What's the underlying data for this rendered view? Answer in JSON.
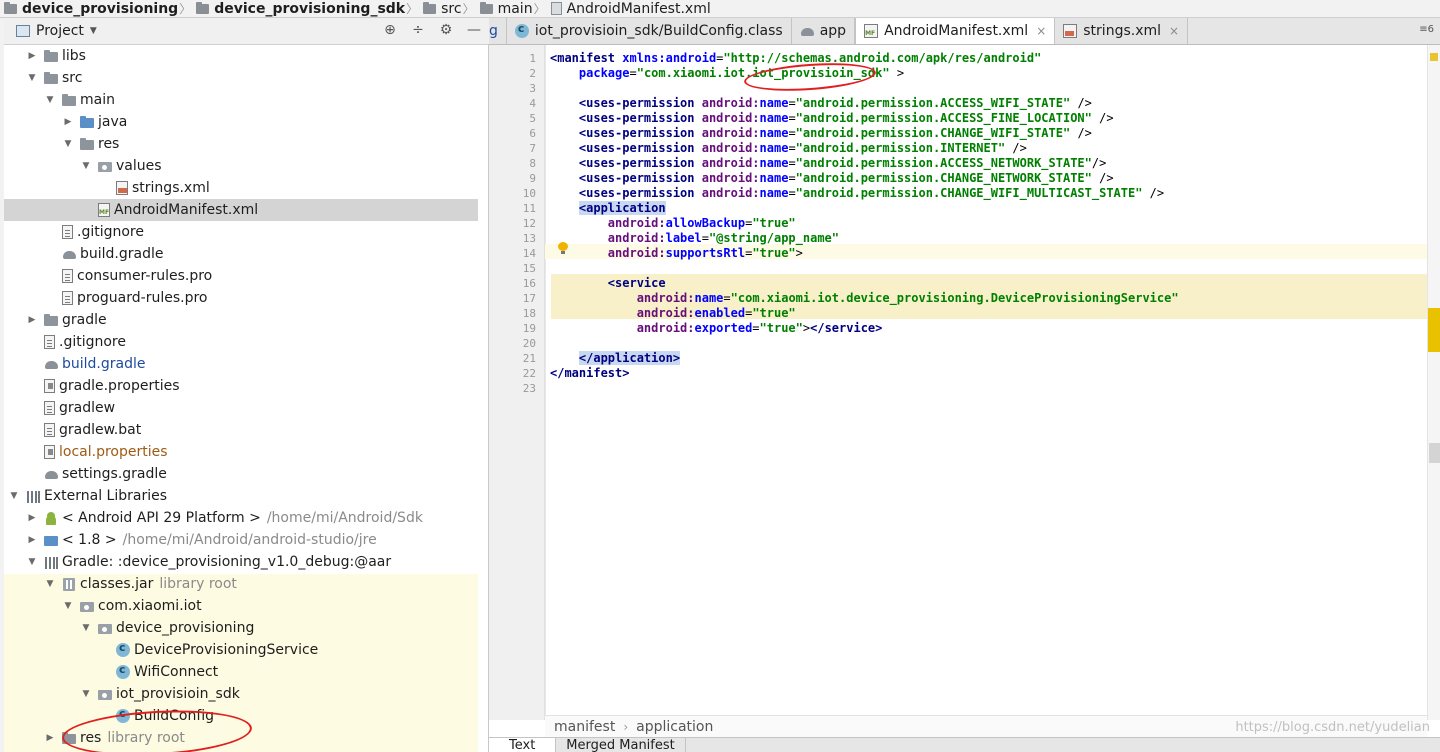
{
  "breadcrumb": {
    "items": [
      "device_provisioning",
      "device_provisioning_sdk",
      "src",
      "main",
      "AndroidManifest.xml"
    ]
  },
  "project_pane": {
    "title": "Project",
    "tools": [
      "⊕",
      "÷",
      "⚙",
      "—"
    ]
  },
  "tree": [
    {
      "indent": 1,
      "arrow": "▶",
      "icon": "folder-icon",
      "label": "libs"
    },
    {
      "indent": 1,
      "arrow": "▼",
      "icon": "folder-icon",
      "label": "src"
    },
    {
      "indent": 2,
      "arrow": "▼",
      "icon": "folder-icon",
      "label": "main"
    },
    {
      "indent": 3,
      "arrow": "▶",
      "icon": "folder-blue-icon",
      "label": "java"
    },
    {
      "indent": 3,
      "arrow": "▼",
      "icon": "res-folder-icon",
      "label": "res"
    },
    {
      "indent": 4,
      "arrow": "▼",
      "icon": "package-icon",
      "label": "values"
    },
    {
      "indent": 5,
      "arrow": "",
      "icon": "xml-file-icon",
      "label": "strings.xml"
    },
    {
      "indent": 4,
      "arrow": "",
      "icon": "manifest-file-icon",
      "label": "AndroidManifest.xml",
      "selected": true
    },
    {
      "indent": 2,
      "arrow": "",
      "icon": "file-icon",
      "label": ".gitignore"
    },
    {
      "indent": 2,
      "arrow": "",
      "icon": "gradle-icon",
      "label": "build.gradle"
    },
    {
      "indent": 2,
      "arrow": "",
      "icon": "file-icon",
      "label": "consumer-rules.pro"
    },
    {
      "indent": 2,
      "arrow": "",
      "icon": "file-icon",
      "label": "proguard-rules.pro"
    },
    {
      "indent": 1,
      "arrow": "▶",
      "icon": "folder-icon",
      "label": "gradle"
    },
    {
      "indent": 1,
      "arrow": "",
      "icon": "file-icon",
      "label": ".gitignore"
    },
    {
      "indent": 1,
      "arrow": "",
      "icon": "gradle-icon",
      "label": "build.gradle",
      "color": "blue"
    },
    {
      "indent": 1,
      "arrow": "",
      "icon": "properties-icon",
      "label": "gradle.properties"
    },
    {
      "indent": 1,
      "arrow": "",
      "icon": "file-icon",
      "label": "gradlew"
    },
    {
      "indent": 1,
      "arrow": "",
      "icon": "file-icon",
      "label": "gradlew.bat"
    },
    {
      "indent": 1,
      "arrow": "",
      "icon": "properties-icon",
      "label": "local.properties",
      "color": "brown"
    },
    {
      "indent": 1,
      "arrow": "",
      "icon": "gradle-icon",
      "label": "settings.gradle"
    },
    {
      "indent": 0,
      "arrow": "▼",
      "icon": "libraries-icon",
      "label": "External Libraries"
    },
    {
      "indent": 1,
      "arrow": "▶",
      "icon": "android-icon",
      "label": "< Android API 29 Platform >",
      "path": "/home/mi/Android/Sdk"
    },
    {
      "indent": 1,
      "arrow": "▶",
      "icon": "jdk-icon",
      "label": "< 1.8 >",
      "path": "/home/mi/Android/android-studio/jre"
    },
    {
      "indent": 1,
      "arrow": "▼",
      "icon": "libraries-icon",
      "label": "Gradle: :device_provisioning_v1.0_debug:@aar"
    },
    {
      "indent": 2,
      "arrow": "▼",
      "icon": "jar-icon",
      "label": "classes.jar",
      "path": "library root"
    },
    {
      "indent": 3,
      "arrow": "▼",
      "icon": "package-icon",
      "label": "com.xiaomi.iot"
    },
    {
      "indent": 4,
      "arrow": "▼",
      "icon": "package-icon",
      "label": "device_provisioning"
    },
    {
      "indent": 5,
      "arrow": "",
      "icon": "class-icon",
      "label": "DeviceProvisioningService"
    },
    {
      "indent": 5,
      "arrow": "",
      "icon": "class-icon",
      "label": "WifiConnect"
    },
    {
      "indent": 4,
      "arrow": "▼",
      "icon": "package-icon",
      "label": "iot_provisioin_sdk"
    },
    {
      "indent": 5,
      "arrow": "",
      "icon": "class-icon",
      "label": "BuildConfig"
    },
    {
      "indent": 2,
      "arrow": "▶",
      "icon": "folder-icon",
      "label": "res",
      "path": "library root"
    }
  ],
  "editor": {
    "tabs": [
      {
        "label": "g",
        "icon": "",
        "cut": true
      },
      {
        "label": "iot_provisioin_sdk/BuildConfig.class",
        "icon": "class-icon",
        "close": false
      },
      {
        "label": "app",
        "icon": "gradle-icon",
        "close": false
      },
      {
        "label": "AndroidManifest.xml",
        "icon": "manifest-file-icon",
        "close": true,
        "active": true
      },
      {
        "label": "strings.xml",
        "icon": "xml-file-icon",
        "close": true
      }
    ],
    "tab_more": "≡6",
    "line_numbers": [
      "1",
      "2",
      "3",
      "4",
      "5",
      "6",
      "7",
      "8",
      "9",
      "10",
      "11",
      "12",
      "13",
      "14",
      "15",
      "16",
      "17",
      "18",
      "19",
      "20",
      "21",
      "22",
      "23"
    ],
    "code_lines": [
      [
        [
          "tag",
          "<manifest "
        ],
        [
          "attr",
          "xmlns:android"
        ],
        [
          "txt",
          "="
        ],
        [
          "str",
          "\"http://schemas.android.com/apk/res/android\""
        ]
      ],
      [
        [
          "txt",
          "    "
        ],
        [
          "attr",
          "package"
        ],
        [
          "txt",
          "="
        ],
        [
          "str",
          "\"com.xiaomi.iot.iot_provisioin_sdk\""
        ],
        [
          "txt",
          " >"
        ]
      ],
      [],
      [
        [
          "txt",
          "    "
        ],
        [
          "tag",
          "<uses-permission "
        ],
        [
          "ns",
          "android:"
        ],
        [
          "attr",
          "name"
        ],
        [
          "txt",
          "="
        ],
        [
          "str",
          "\"android.permission.ACCESS_WIFI_STATE\""
        ],
        [
          "txt",
          " />"
        ]
      ],
      [
        [
          "txt",
          "    "
        ],
        [
          "tag",
          "<uses-permission "
        ],
        [
          "ns",
          "android:"
        ],
        [
          "attr",
          "name"
        ],
        [
          "txt",
          "="
        ],
        [
          "str",
          "\"android.permission.ACCESS_FINE_LOCATION\""
        ],
        [
          "txt",
          " />"
        ]
      ],
      [
        [
          "txt",
          "    "
        ],
        [
          "tag",
          "<uses-permission "
        ],
        [
          "ns",
          "android:"
        ],
        [
          "attr",
          "name"
        ],
        [
          "txt",
          "="
        ],
        [
          "str",
          "\"android.permission.CHANGE_WIFI_STATE\""
        ],
        [
          "txt",
          " />"
        ]
      ],
      [
        [
          "txt",
          "    "
        ],
        [
          "tag",
          "<uses-permission "
        ],
        [
          "ns",
          "android:"
        ],
        [
          "attr",
          "name"
        ],
        [
          "txt",
          "="
        ],
        [
          "str",
          "\"android.permission.INTERNET\""
        ],
        [
          "txt",
          " />"
        ]
      ],
      [
        [
          "txt",
          "    "
        ],
        [
          "tag",
          "<uses-permission "
        ],
        [
          "ns",
          "android:"
        ],
        [
          "attr",
          "name"
        ],
        [
          "txt",
          "="
        ],
        [
          "str",
          "\"android.permission.ACCESS_NETWORK_STATE\""
        ],
        [
          "txt",
          "/>"
        ]
      ],
      [
        [
          "txt",
          "    "
        ],
        [
          "tag",
          "<uses-permission "
        ],
        [
          "ns",
          "android:"
        ],
        [
          "attr",
          "name"
        ],
        [
          "txt",
          "="
        ],
        [
          "str",
          "\"android.permission.CHANGE_NETWORK_STATE\""
        ],
        [
          "txt",
          " />"
        ]
      ],
      [
        [
          "txt",
          "    "
        ],
        [
          "tag",
          "<uses-permission "
        ],
        [
          "ns",
          "android:"
        ],
        [
          "attr",
          "name"
        ],
        [
          "txt",
          "="
        ],
        [
          "str",
          "\"android.permission.CHANGE_WIFI_MULTICAST_STATE\""
        ],
        [
          "txt",
          " />"
        ]
      ],
      [
        [
          "txt",
          "    "
        ],
        [
          "taghl",
          "<application"
        ]
      ],
      [
        [
          "txt",
          "        "
        ],
        [
          "ns",
          "android:"
        ],
        [
          "attr",
          "allowBackup"
        ],
        [
          "txt",
          "="
        ],
        [
          "str",
          "\"true\""
        ]
      ],
      [
        [
          "txt",
          "        "
        ],
        [
          "ns",
          "android:"
        ],
        [
          "attr",
          "label"
        ],
        [
          "txt",
          "="
        ],
        [
          "str",
          "\"@string/app_name\""
        ]
      ],
      [
        [
          "txt",
          "        "
        ],
        [
          "ns",
          "android:"
        ],
        [
          "attr",
          "supportsRtl"
        ],
        [
          "txt",
          "="
        ],
        [
          "str",
          "\"true\""
        ],
        [
          "txt",
          ">"
        ]
      ],
      [],
      [
        [
          "txt",
          "        "
        ],
        [
          "tag",
          "<service"
        ]
      ],
      [
        [
          "txt",
          "            "
        ],
        [
          "ns",
          "android:"
        ],
        [
          "attr",
          "name"
        ],
        [
          "txt",
          "="
        ],
        [
          "str",
          "\"com.xiaomi.iot.device_provisioning.DeviceProvisioningService\""
        ]
      ],
      [
        [
          "txt",
          "            "
        ],
        [
          "ns",
          "android:"
        ],
        [
          "attr",
          "enabled"
        ],
        [
          "txt",
          "="
        ],
        [
          "str",
          "\"true\""
        ]
      ],
      [
        [
          "txt",
          "            "
        ],
        [
          "ns",
          "android:"
        ],
        [
          "attr",
          "exported"
        ],
        [
          "txt",
          "="
        ],
        [
          "str",
          "\"true\""
        ],
        [
          "txt",
          ">"
        ],
        [
          "tag",
          "</service>"
        ]
      ],
      [],
      [
        [
          "txt",
          "    "
        ],
        [
          "taghl",
          "</application>"
        ]
      ],
      [
        [
          "tag",
          "</manifest>"
        ]
      ],
      []
    ],
    "crumbs": [
      "manifest",
      "application"
    ],
    "bottom_tabs": [
      "Text",
      "Merged Manifest"
    ],
    "watermark": "https://blog.csdn.net/yudelian"
  },
  "colors": {
    "annotation_red": "#e02020",
    "selection_gray": "#d4d4d4",
    "string_green": "#008000",
    "tag_navy": "#000080",
    "attr_blue": "#0000ff"
  }
}
